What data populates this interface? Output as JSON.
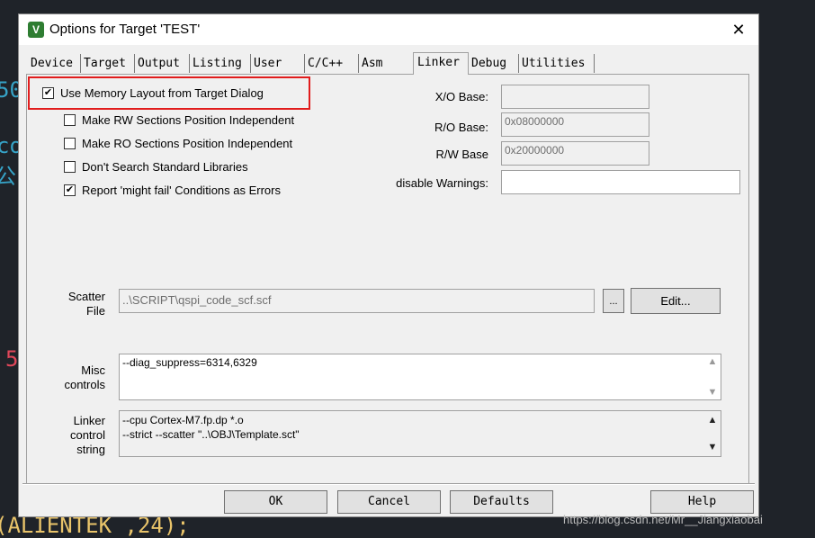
{
  "background": {
    "code_fragments": [
      "50",
      "co",
      "公",
      "5",
      "(ALIENTEK ,24);"
    ]
  },
  "dialog": {
    "title": "Options for Target 'TEST'",
    "app_icon": "V"
  },
  "tabs": [
    "Device",
    "Target",
    "Output",
    "Listing",
    "User",
    "C/C++",
    "Asm",
    "Linker",
    "Debug",
    "Utilities"
  ],
  "active_tab": "Linker",
  "options": [
    {
      "label": "Use Memory Layout from Target Dialog",
      "checked": true
    },
    {
      "label": "Make RW Sections Position Independent",
      "checked": false
    },
    {
      "label": "Make RO Sections Position Independent",
      "checked": false
    },
    {
      "label": "Don't Search Standard Libraries",
      "checked": false
    },
    {
      "label": "Report 'might fail' Conditions as Errors",
      "checked": true
    }
  ],
  "bases": {
    "xo_label": "X/O Base:",
    "xo_value": "",
    "ro_label": "R/O Base:",
    "ro_value": "0x08000000",
    "rw_label": "R/W Base",
    "rw_value": "0x20000000",
    "warn_label": "disable Warnings:",
    "warn_value": ""
  },
  "scatter": {
    "label_line1": "Scatter",
    "label_line2": "File",
    "value": "..\\SCRIPT\\qspi_code_scf.scf",
    "browse_label": "...",
    "edit_label": "Edit..."
  },
  "misc": {
    "label_line1": "Misc",
    "label_line2": "controls",
    "value": "--diag_suppress=6314,6329"
  },
  "linker_string": {
    "label_line1": "Linker",
    "label_line2": "control",
    "label_line3": "string",
    "line1": "--cpu Cortex-M7.fp.dp *.o",
    "line2": "--strict --scatter \"..\\OBJ\\Template.sct\""
  },
  "buttons": {
    "ok": "OK",
    "cancel": "Cancel",
    "defaults": "Defaults",
    "help": "Help"
  },
  "watermark": "https://blog.csdn.net/Mr__Jiangxiaobai",
  "colors": {
    "highlight": "#e11c1c",
    "code_cyan": "#36a3c7",
    "code_red": "#e0475a",
    "code_yellow": "#e9c46a"
  }
}
